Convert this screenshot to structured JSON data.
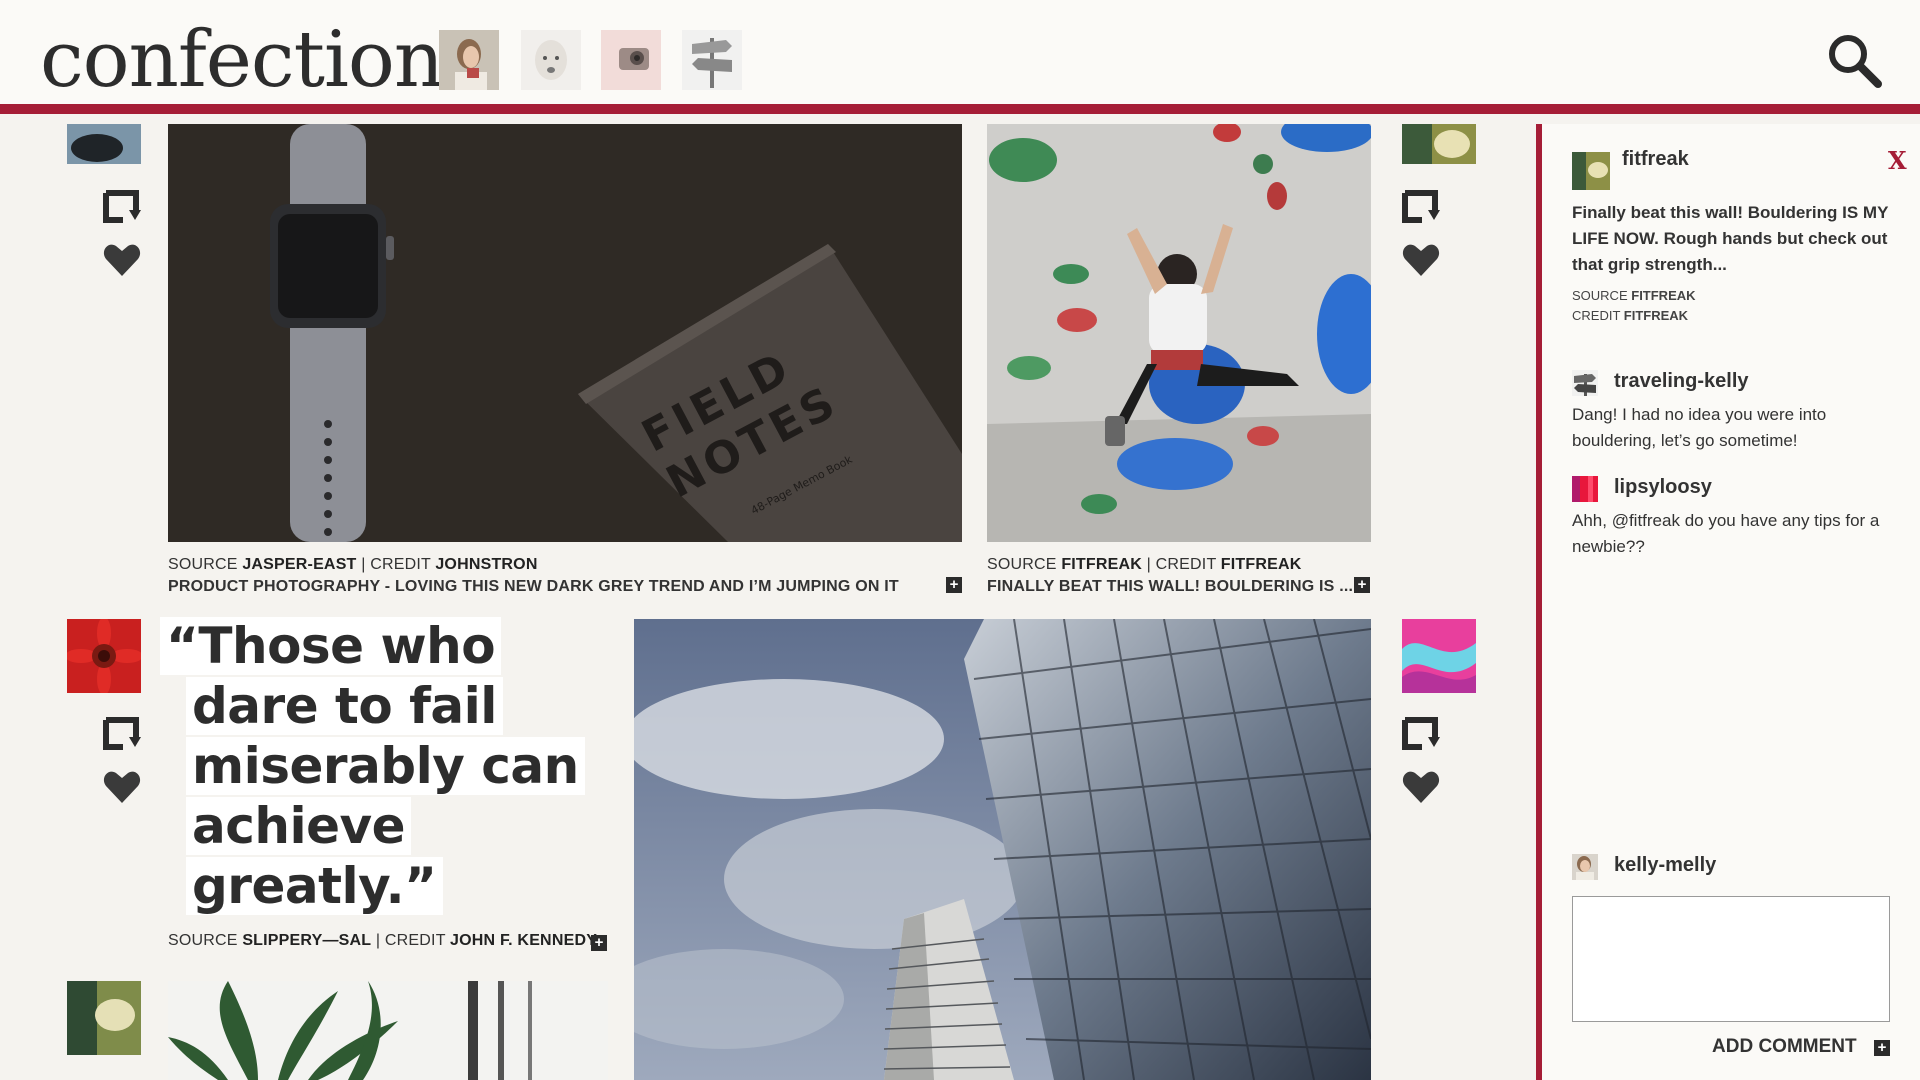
{
  "header": {
    "logo": "confection",
    "thumbnails": [
      "profile-woman-icon",
      "dog-icon",
      "camera-icon",
      "signpost-icon"
    ]
  },
  "posts": [
    {
      "source_label": "SOURCE",
      "source": "JASPER-EAST",
      "credit_label": "CREDIT",
      "credit": "JOHNSTRON",
      "caption": "PRODUCT PHOTOGRAPHY - LOVING THIS NEW DARK GREY TREND AND I’M JUMPING ON IT",
      "notebook_line1": "FIELD",
      "notebook_line2": "NOTES",
      "notebook_small": "48-Page Memo Book"
    },
    {
      "source_label": "SOURCE",
      "source": "FITFREAK",
      "credit_label": "CREDIT",
      "credit": "FITFREAK",
      "caption": "FINALLY BEAT THIS WALL! BOULDERING IS ..."
    },
    {
      "source_label": "SOURCE",
      "source": "SLIPPERY—SAL",
      "credit_label": "CREDIT",
      "credit": "JOHN F. KENNEDY",
      "quote_lines": [
        "“Those who",
        "dare to fail",
        "miserably can",
        "achieve",
        "greatly.”"
      ]
    }
  ],
  "panel": {
    "close_label": "X",
    "post_author": "fitfreak",
    "post_text": "Finally beat this wall! Bouldering IS MY LIFE NOW. Rough hands but check out that grip strength...",
    "source_label": "SOURCE",
    "source": "FITFREAK",
    "credit_label": "CREDIT",
    "credit": "FITFREAK",
    "comments": [
      {
        "user": "traveling-kelly",
        "text": "Dang! I had no idea you were into bouldering, let’s go sometime!"
      },
      {
        "user": "lipsyloosy",
        "text": "Ahh, @fitfreak do you have any tips for a newbie??"
      }
    ],
    "current_user": "kelly-melly",
    "comment_placeholder": "",
    "add_comment_label": "ADD COMMENT",
    "plus_label": "+"
  },
  "colors": {
    "accent": "#a51d36",
    "text": "#2b2b2b",
    "background": "#f5f3ef"
  }
}
